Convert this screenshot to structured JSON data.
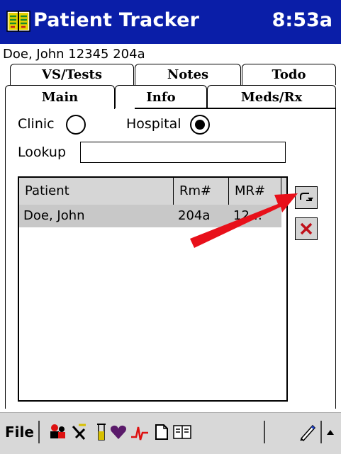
{
  "titlebar": {
    "title": "Patient Tracker",
    "clock": "8:53a",
    "app_icon": "book-icon"
  },
  "patient_summary": "Doe, John 12345 204a",
  "tabs": {
    "row1": [
      "VS/Tests",
      "Notes",
      "Todo"
    ],
    "row2": [
      "Main",
      "Info",
      "Meds/Rx"
    ],
    "active": "Main"
  },
  "filter": {
    "clinic_label": "Clinic",
    "hospital_label": "Hospital",
    "selected": "Hospital",
    "lookup_label": "Lookup",
    "lookup_value": ""
  },
  "list": {
    "columns": [
      "Patient",
      "Rm#",
      "MR#"
    ],
    "rows": [
      {
        "patient": "Doe, John",
        "room": "204a",
        "mr": "12…"
      }
    ]
  },
  "side_buttons": [
    "refresh-icon",
    "delete-icon"
  ],
  "toolbar": {
    "file_label": "File",
    "icons": [
      "patients-icon",
      "rx-icon",
      "test-tube-icon",
      "heart-icon",
      "ecg-icon",
      "note-icon",
      "book-icon",
      "pen-icon",
      "menu-arrow-icon"
    ]
  },
  "colors": {
    "titlebar": "#0a1ea8",
    "highlight_row": "#c8c8c8",
    "arrow": "#e8101a",
    "delete_x": "#c0101a"
  }
}
